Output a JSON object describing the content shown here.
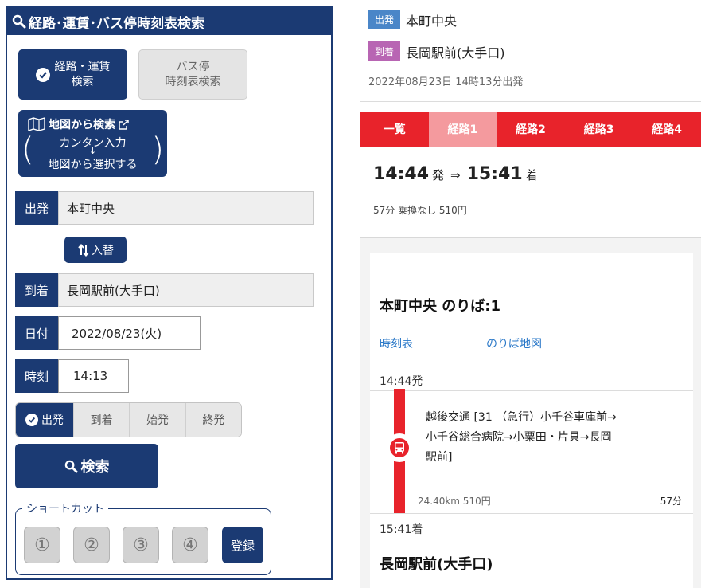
{
  "search_panel": {
    "title": "経路･運賃･バス停時刻表検索",
    "mode_route": {
      "line1": "経路・運賃",
      "line2": "検索"
    },
    "mode_timetable": {
      "line1": "バス停",
      "line2": "時刻表検索"
    },
    "map_search": {
      "title": "地図から検索",
      "line1": "カンタン入力",
      "arrow": "↓",
      "line2": "地図から選択する"
    },
    "from": {
      "label": "出発",
      "value": "本町中央"
    },
    "swap_label": "入替",
    "to": {
      "label": "到着",
      "value": "長岡駅前(大手口)"
    },
    "date": {
      "label": "日付",
      "value": "2022/08/23(火)"
    },
    "time": {
      "label": "時刻",
      "value": "14:13"
    },
    "time_modes": [
      {
        "label": "出発",
        "selected": true
      },
      {
        "label": "到着",
        "selected": false
      },
      {
        "label": "始発",
        "selected": false
      },
      {
        "label": "終発",
        "selected": false
      }
    ],
    "search_label": "検索",
    "shortcut": {
      "title": "ショートカット",
      "items": [
        "①",
        "②",
        "③",
        "④"
      ],
      "register_label": "登録"
    }
  },
  "result": {
    "from_badge": "出発",
    "from_name": "本町中央",
    "to_badge": "到着",
    "to_name": "長岡駅前(大手口)",
    "depart_info": "2022年08月23日 14時13分出発",
    "tabs": [
      "一覧",
      "経路1",
      "経路2",
      "経路3",
      "経路4"
    ],
    "active_tab": "経路1",
    "depart_time": "14:44",
    "depart_suffix": "発",
    "arrow": "⇒",
    "arrive_time": "15:41",
    "arrive_suffix": "着",
    "summary": "57分  乗換なし 510円",
    "stop_title": "本町中央  のりば:1",
    "link_timetable": "時刻表",
    "link_map": "のりば地図",
    "leg_depart": "14:44発",
    "route_line1": "越後交通 [31 （急行）小千谷車庫前→",
    "route_line2": "小千谷総合病院→小粟田・片貝→長岡",
    "route_line3": "駅前]",
    "distance_fare": "24.40km  510円",
    "duration": "57分",
    "leg_arrive": "15:41着",
    "arrive_stop": "長岡駅前(大手口)"
  },
  "colors": {
    "navy": "#1b3a73",
    "red": "#e8232b",
    "depart_badge": "#4a86c8",
    "arrive_badge": "#b865b3",
    "link": "#2a78c8"
  }
}
